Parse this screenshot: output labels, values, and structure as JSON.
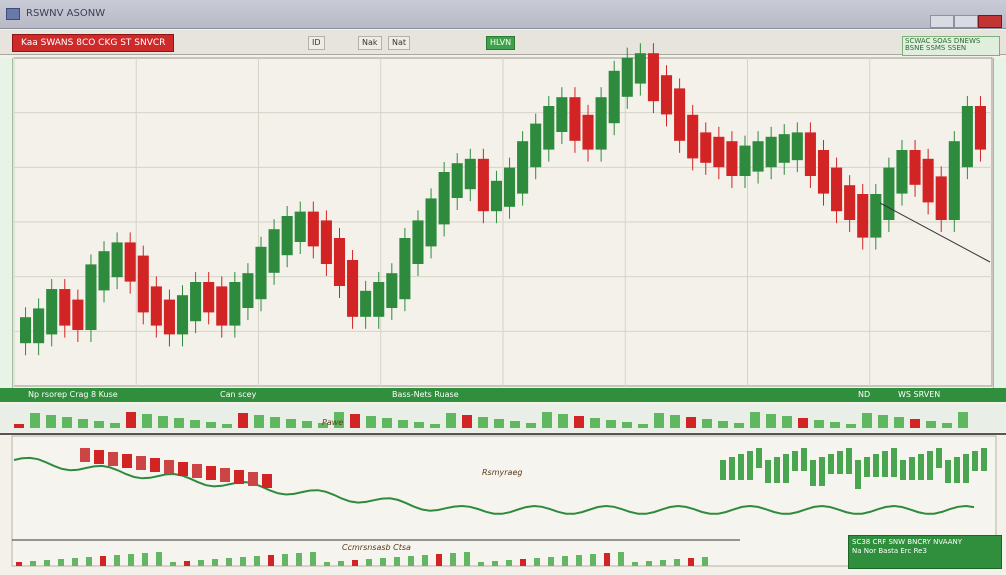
{
  "window": {
    "title": "RSWNV ASONW"
  },
  "toolbar": {
    "symbol_label": "Kaa SWANS 8CO CKG ST SNVCR",
    "items": [
      "ID",
      "Nak",
      "Nat"
    ],
    "badge": "HLVN"
  },
  "info_panel": {
    "text": "SCWAC SOAS DNEWS BSNE SSMS SSEN"
  },
  "status_bar": {
    "left_text": "Np rsorep Crag  8 Kuse",
    "mid_text": "Can scey",
    "center_text": "Bass-Nets Ruase",
    "right_a": "ND",
    "right_b": "WS SRVEN"
  },
  "lower_pane": {
    "tab": "Pawe",
    "annotation": "Rsmyraeg"
  },
  "bottom_label": "Ccmrsnsasb Ctsa",
  "bottom_panel": {
    "line1": "SC38 CRF SNW BNCRY NVAANY",
    "line2": "Na Nor Basta Erc Re3"
  },
  "colors": {
    "up": "#2e8b3e",
    "down": "#d22424",
    "grid": "#d6d3c7",
    "bg": "#f3f1ea",
    "accent": "#2f8f3c"
  },
  "price_series": [
    60,
    70,
    92,
    80,
    75,
    120,
    135,
    145,
    130,
    95,
    80,
    70,
    85,
    100,
    95,
    80,
    100,
    110,
    140,
    160,
    175,
    180,
    170,
    150,
    125,
    90,
    90,
    100,
    110,
    150,
    170,
    195,
    225,
    235,
    240,
    210,
    215,
    230,
    260,
    280,
    300,
    310,
    290,
    280,
    310,
    340,
    355,
    360,
    335,
    320,
    290,
    270,
    265,
    260,
    250,
    255,
    260,
    265,
    268,
    270,
    250,
    230,
    210,
    200,
    180,
    200,
    230,
    250,
    240,
    220,
    200,
    260,
    300,
    280
  ]
}
